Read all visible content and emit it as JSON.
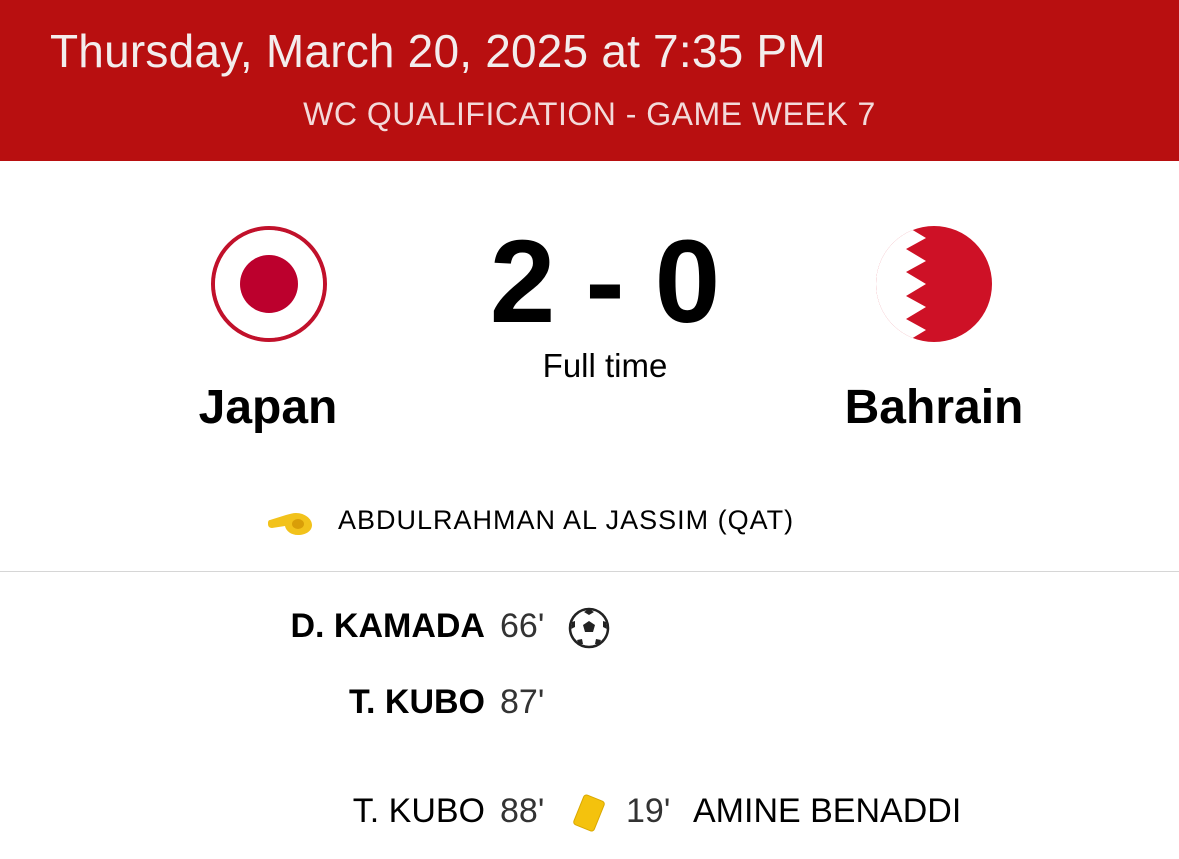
{
  "header": {
    "date_time": "Thursday, March 20, 2025 at 7:35 PM",
    "competition": "WC QUALIFICATION - GAME WEEK 7"
  },
  "match": {
    "home": {
      "name": "Japan",
      "flag_icon": "japan-flag-icon",
      "score": "2"
    },
    "away": {
      "name": "Bahrain",
      "flag_icon": "bahrain-flag-icon",
      "score": "0"
    },
    "separator": "-",
    "status": "Full time"
  },
  "referee": {
    "icon": "whistle-icon",
    "name": "ABDULRAHMAN AL JASSIM (QAT)"
  },
  "events": [
    {
      "player": "D. KAMADA",
      "minute": "66'",
      "icon": "soccer-ball-icon"
    },
    {
      "player": "T. KUBO",
      "minute": "87'"
    },
    {
      "player": "T. KUBO",
      "minute": "88'",
      "icon": "yellow-card-icon",
      "away_minute": "19'",
      "away_player": "AMINE BENADDI"
    }
  ],
  "colors": {
    "header_bg": "#b80f10",
    "japan_red": "#bc002d",
    "bahrain_red": "#ce1126",
    "yellow_card": "#f4c20d"
  }
}
